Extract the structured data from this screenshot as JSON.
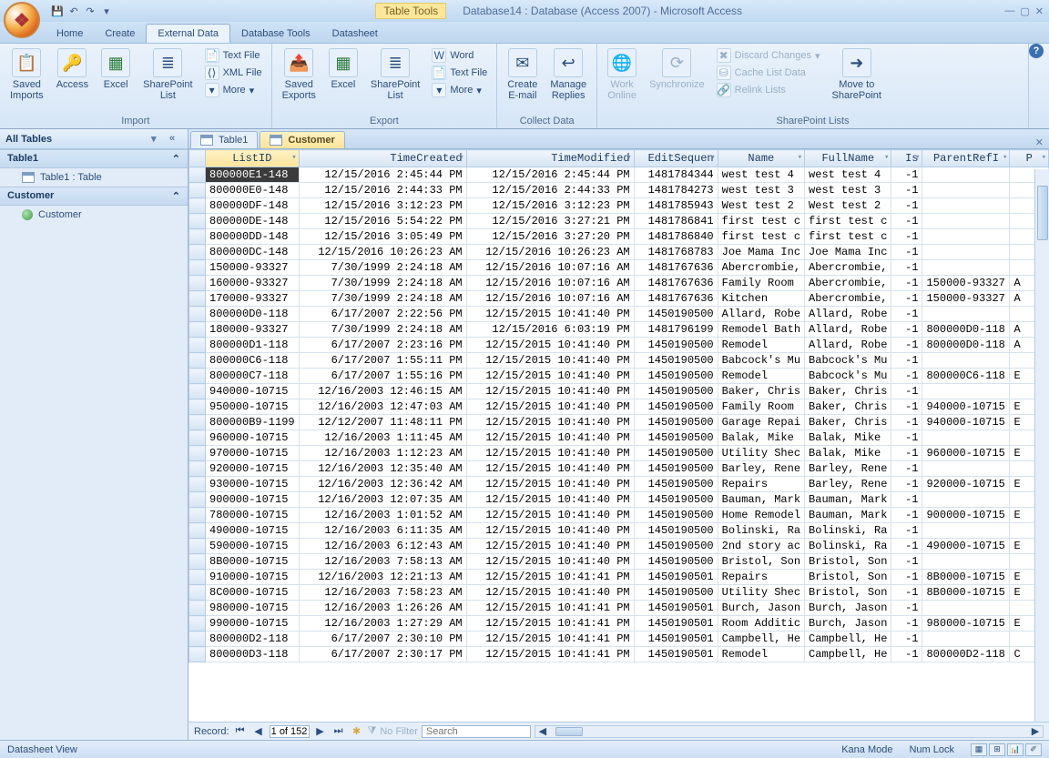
{
  "app": {
    "title_context": "Table Tools",
    "title": "Database14 : Database (Access 2007) - Microsoft Access"
  },
  "menus": [
    "Home",
    "Create",
    "External Data",
    "Database Tools",
    "Datasheet"
  ],
  "active_menu": 2,
  "ribbon": {
    "import": {
      "label": "Import",
      "saved_imports": "Saved\nImports",
      "access": "Access",
      "excel": "Excel",
      "sp_list": "SharePoint\nList",
      "text": "Text File",
      "xml": "XML File",
      "more": "More"
    },
    "export": {
      "label": "Export",
      "saved_exports": "Saved\nExports",
      "excel": "Excel",
      "sp_list": "SharePoint\nList",
      "word": "Word",
      "text": "Text File",
      "more": "More"
    },
    "collect": {
      "label": "Collect Data",
      "create": "Create\nE-mail",
      "manage": "Manage\nReplies"
    },
    "sp": {
      "label": "SharePoint Lists",
      "work_online": "Work\nOnline",
      "sync": "Synchronize",
      "discard": "Discard Changes",
      "cache": "Cache List Data",
      "relink": "Relink Lists",
      "move": "Move to\nSharePoint"
    }
  },
  "nav": {
    "header": "All Tables",
    "groups": [
      {
        "title": "Table1",
        "items": [
          {
            "label": "Table1 : Table",
            "type": "table"
          }
        ]
      },
      {
        "title": "Customer",
        "items": [
          {
            "label": "Customer",
            "type": "link"
          }
        ]
      }
    ]
  },
  "doc_tabs": [
    {
      "label": "Table1"
    },
    {
      "label": "Customer"
    }
  ],
  "active_doc_tab": 1,
  "columns": [
    "ListID",
    "TimeCreated",
    "TimeModified",
    "EditSequen",
    "Name",
    "FullName",
    "Is",
    "ParentRefI",
    "P"
  ],
  "rows": [
    [
      "800000E1-148",
      "12/15/2016 2:45:44 PM",
      "12/15/2016 2:45:44 PM",
      "1481784344",
      "west test 4",
      "west test 4",
      "-1",
      "",
      ""
    ],
    [
      "800000E0-148",
      "12/15/2016 2:44:33 PM",
      "12/15/2016 2:44:33 PM",
      "1481784273",
      "west test 3",
      "west test 3",
      "-1",
      "",
      ""
    ],
    [
      "800000DF-148",
      "12/15/2016 3:12:23 PM",
      "12/15/2016 3:12:23 PM",
      "1481785943",
      "West test 2",
      "West test 2",
      "-1",
      "",
      ""
    ],
    [
      "800000DE-148",
      "12/15/2016 5:54:22 PM",
      "12/15/2016 3:27:21 PM",
      "1481786841",
      "first test c",
      "first test c",
      "-1",
      "",
      ""
    ],
    [
      "800000DD-148",
      "12/15/2016 3:05:49 PM",
      "12/15/2016 3:27:20 PM",
      "1481786840",
      "first test c",
      "first test c",
      "-1",
      "",
      ""
    ],
    [
      "800000DC-148",
      "12/15/2016 10:26:23 AM",
      "12/15/2016 10:26:23 AM",
      "1481768783",
      "Joe Mama Inc",
      "Joe Mama Inc",
      "-1",
      "",
      ""
    ],
    [
      "150000-93327",
      "7/30/1999 2:24:18 AM",
      "12/15/2016 10:07:16 AM",
      "1481767636",
      "Abercrombie,",
      "Abercrombie,",
      "-1",
      "",
      ""
    ],
    [
      "160000-93327",
      "7/30/1999 2:24:18 AM",
      "12/15/2016 10:07:16 AM",
      "1481767636",
      "Family Room",
      "Abercrombie,",
      "-1",
      "150000-93327",
      "A"
    ],
    [
      "170000-93327",
      "7/30/1999 2:24:18 AM",
      "12/15/2016 10:07:16 AM",
      "1481767636",
      "Kitchen",
      "Abercrombie,",
      "-1",
      "150000-93327",
      "A"
    ],
    [
      "800000D0-118",
      "6/17/2007 2:22:56 PM",
      "12/15/2015 10:41:40 PM",
      "1450190500",
      "Allard, Robe",
      "Allard, Robe",
      "-1",
      "",
      ""
    ],
    [
      "180000-93327",
      "7/30/1999 2:24:18 AM",
      "12/15/2016 6:03:19 PM",
      "1481796199",
      "Remodel Bath",
      "Allard, Robe",
      "-1",
      "800000D0-118",
      "A"
    ],
    [
      "800000D1-118",
      "6/17/2007 2:23:16 PM",
      "12/15/2015 10:41:40 PM",
      "1450190500",
      "Remodel",
      "Allard, Robe",
      "-1",
      "800000D0-118",
      "A"
    ],
    [
      "800000C6-118",
      "6/17/2007 1:55:11 PM",
      "12/15/2015 10:41:40 PM",
      "1450190500",
      "Babcock's Mu",
      "Babcock's Mu",
      "-1",
      "",
      ""
    ],
    [
      "800000C7-118",
      "6/17/2007 1:55:16 PM",
      "12/15/2015 10:41:40 PM",
      "1450190500",
      "Remodel",
      "Babcock's Mu",
      "-1",
      "800000C6-118",
      "E"
    ],
    [
      "940000-10715",
      "12/16/2003 12:46:15 AM",
      "12/15/2015 10:41:40 PM",
      "1450190500",
      "Baker, Chris",
      "Baker, Chris",
      "-1",
      "",
      ""
    ],
    [
      "950000-10715",
      "12/16/2003 12:47:03 AM",
      "12/15/2015 10:41:40 PM",
      "1450190500",
      "Family Room",
      "Baker, Chris",
      "-1",
      "940000-10715",
      "E"
    ],
    [
      "800000B9-1199",
      "12/12/2007 11:48:11 PM",
      "12/15/2015 10:41:40 PM",
      "1450190500",
      "Garage Repai",
      "Baker, Chris",
      "-1",
      "940000-10715",
      "E"
    ],
    [
      "960000-10715",
      "12/16/2003 1:11:45 AM",
      "12/15/2015 10:41:40 PM",
      "1450190500",
      "Balak, Mike",
      "Balak, Mike",
      "-1",
      "",
      ""
    ],
    [
      "970000-10715",
      "12/16/2003 1:12:23 AM",
      "12/15/2015 10:41:40 PM",
      "1450190500",
      "Utility Shec",
      "Balak, Mike",
      "-1",
      "960000-10715",
      "E"
    ],
    [
      "920000-10715",
      "12/16/2003 12:35:40 AM",
      "12/15/2015 10:41:40 PM",
      "1450190500",
      "Barley, Rene",
      "Barley, Rene",
      "-1",
      "",
      ""
    ],
    [
      "930000-10715",
      "12/16/2003 12:36:42 AM",
      "12/15/2015 10:41:40 PM",
      "1450190500",
      "Repairs",
      "Barley, Rene",
      "-1",
      "920000-10715",
      "E"
    ],
    [
      "900000-10715",
      "12/16/2003 12:07:35 AM",
      "12/15/2015 10:41:40 PM",
      "1450190500",
      "Bauman, Mark",
      "Bauman, Mark",
      "-1",
      "",
      ""
    ],
    [
      "780000-10715",
      "12/16/2003 1:01:52 AM",
      "12/15/2015 10:41:40 PM",
      "1450190500",
      "Home Remodel",
      "Bauman, Mark",
      "-1",
      "900000-10715",
      "E"
    ],
    [
      "490000-10715",
      "12/16/2003 6:11:35 AM",
      "12/15/2015 10:41:40 PM",
      "1450190500",
      "Bolinski, Ra",
      "Bolinski, Ra",
      "-1",
      "",
      ""
    ],
    [
      "590000-10715",
      "12/16/2003 6:12:43 AM",
      "12/15/2015 10:41:40 PM",
      "1450190500",
      "2nd story ac",
      "Bolinski, Ra",
      "-1",
      "490000-10715",
      "E"
    ],
    [
      "8B0000-10715",
      "12/16/2003 7:58:13 AM",
      "12/15/2015 10:41:40 PM",
      "1450190500",
      "Bristol, Son",
      "Bristol, Son",
      "-1",
      "",
      ""
    ],
    [
      "910000-10715",
      "12/16/2003 12:21:13 AM",
      "12/15/2015 10:41:41 PM",
      "1450190501",
      "Repairs",
      "Bristol, Son",
      "-1",
      "8B0000-10715",
      "E"
    ],
    [
      "8C0000-10715",
      "12/16/2003 7:58:23 AM",
      "12/15/2015 10:41:40 PM",
      "1450190500",
      "Utility Shec",
      "Bristol, Son",
      "-1",
      "8B0000-10715",
      "E"
    ],
    [
      "980000-10715",
      "12/16/2003 1:26:26 AM",
      "12/15/2015 10:41:41 PM",
      "1450190501",
      "Burch, Jason",
      "Burch, Jason",
      "-1",
      "",
      ""
    ],
    [
      "990000-10715",
      "12/16/2003 1:27:29 AM",
      "12/15/2015 10:41:41 PM",
      "1450190501",
      "Room Additic",
      "Burch, Jason",
      "-1",
      "980000-10715",
      "E"
    ],
    [
      "800000D2-118",
      "6/17/2007 2:30:10 PM",
      "12/15/2015 10:41:41 PM",
      "1450190501",
      "Campbell, He",
      "Campbell, He",
      "-1",
      "",
      ""
    ],
    [
      "800000D3-118",
      "6/17/2007 2:30:17 PM",
      "12/15/2015 10:41:41 PM",
      "1450190501",
      "Remodel",
      "Campbell, He",
      "-1",
      "800000D2-118",
      "C"
    ]
  ],
  "record_nav": {
    "label": "Record:",
    "pos": "1 of 152",
    "no_filter": "No Filter",
    "search": "Search"
  },
  "status": {
    "view": "Datasheet View",
    "kana": "Kana Mode",
    "numlock": "Num Lock"
  }
}
